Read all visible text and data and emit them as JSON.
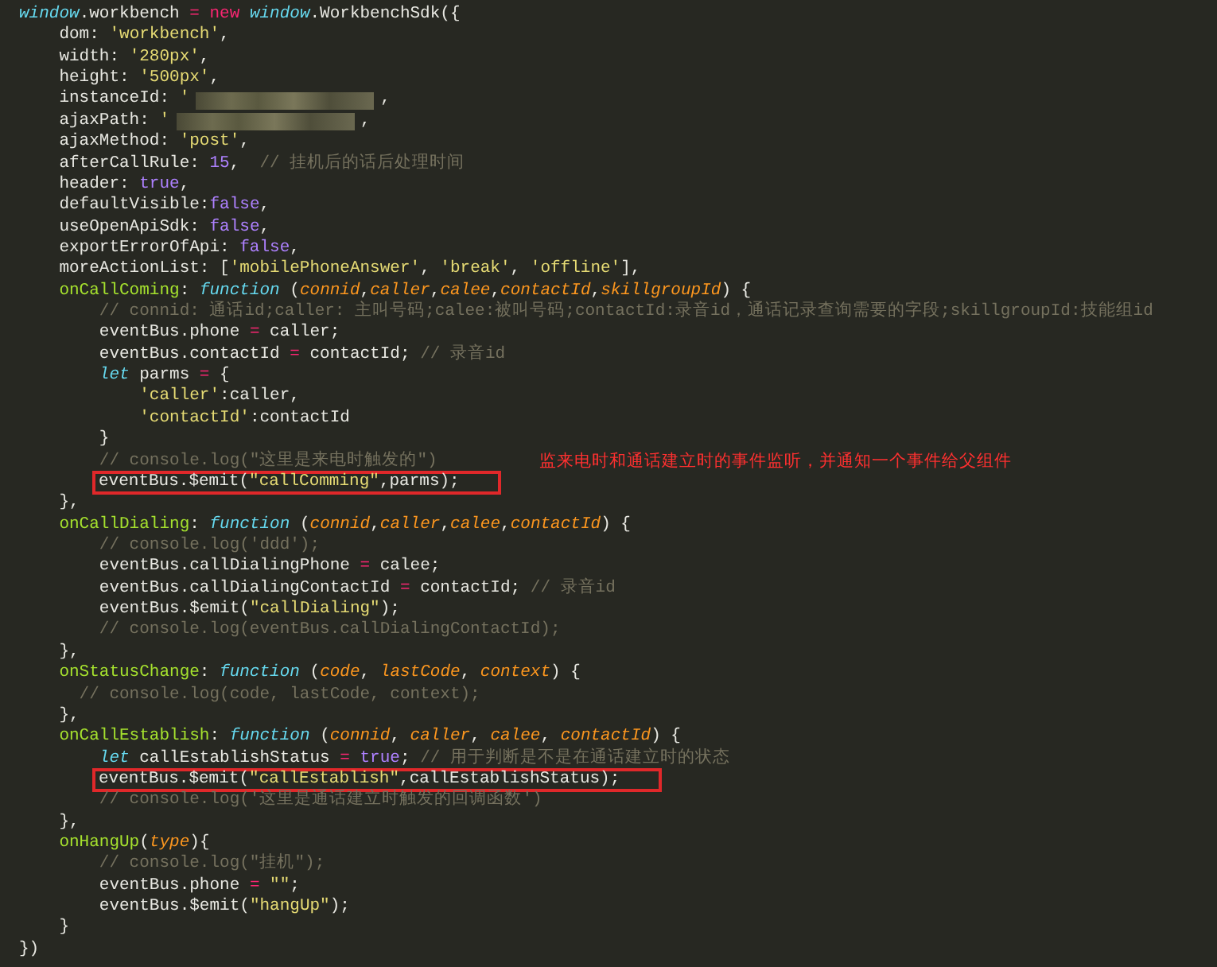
{
  "code_lines": [
    {
      "segments": [
        {
          "kind": "code",
          "tokens": [
            {
              "kind": "keyword",
              "text": "window"
            },
            {
              "kind": "plain",
              "text": ".workbench "
            },
            {
              "kind": "operator",
              "text": "= new"
            },
            {
              "kind": "keyword",
              "text": " window"
            },
            {
              "kind": "plain",
              "text": ".WorkbenchSdk({"
            }
          ]
        }
      ]
    },
    {
      "segments": [
        {
          "kind": "code",
          "tokens": [
            {
              "kind": "plain",
              "text": "    dom: "
            },
            {
              "kind": "string",
              "text": "'workbench'"
            },
            {
              "kind": "plain",
              "text": ","
            }
          ]
        }
      ]
    },
    {
      "segments": [
        {
          "kind": "code",
          "tokens": [
            {
              "kind": "plain",
              "text": "    width: "
            },
            {
              "kind": "string",
              "text": "'280px'"
            },
            {
              "kind": "plain",
              "text": ","
            }
          ]
        }
      ]
    },
    {
      "segments": [
        {
          "kind": "code",
          "tokens": [
            {
              "kind": "plain",
              "text": "    height: "
            },
            {
              "kind": "string",
              "text": "'500px'"
            },
            {
              "kind": "plain",
              "text": ","
            }
          ]
        }
      ]
    },
    {
      "segments": [
        {
          "kind": "code",
          "tokens": [
            {
              "kind": "plain",
              "text": "    instanceId: "
            },
            {
              "kind": "string",
              "text": "'"
            }
          ]
        },
        {
          "kind": "redacted"
        },
        {
          "kind": "code",
          "tokens": [
            {
              "kind": "plain",
              "text": ","
            }
          ]
        }
      ]
    },
    {
      "segments": [
        {
          "kind": "code",
          "tokens": [
            {
              "kind": "plain",
              "text": "    ajaxPath: "
            },
            {
              "kind": "string",
              "text": "'"
            }
          ]
        },
        {
          "kind": "redacted"
        },
        {
          "kind": "code",
          "tokens": [
            {
              "kind": "plain",
              "text": ","
            }
          ]
        }
      ]
    },
    {
      "segments": [
        {
          "kind": "code",
          "tokens": [
            {
              "kind": "plain",
              "text": "    ajaxMethod: "
            },
            {
              "kind": "string",
              "text": "'post'"
            },
            {
              "kind": "plain",
              "text": ","
            }
          ]
        }
      ]
    },
    {
      "segments": [
        {
          "kind": "code",
          "tokens": [
            {
              "kind": "plain",
              "text": "    afterCallRule: "
            },
            {
              "kind": "literal",
              "text": "15"
            },
            {
              "kind": "plain",
              "text": ",  "
            },
            {
              "kind": "comment",
              "text": "// 挂机后的话后处理时间"
            }
          ]
        }
      ]
    },
    {
      "segments": [
        {
          "kind": "code",
          "tokens": [
            {
              "kind": "plain",
              "text": "    header: "
            },
            {
              "kind": "literal",
              "text": "true"
            },
            {
              "kind": "plain",
              "text": ","
            }
          ]
        }
      ]
    },
    {
      "segments": [
        {
          "kind": "code",
          "tokens": [
            {
              "kind": "plain",
              "text": "    defaultVisible:"
            },
            {
              "kind": "literal",
              "text": "false"
            },
            {
              "kind": "plain",
              "text": ","
            }
          ]
        }
      ]
    },
    {
      "segments": [
        {
          "kind": "code",
          "tokens": [
            {
              "kind": "plain",
              "text": "    useOpenApiSdk: "
            },
            {
              "kind": "literal",
              "text": "false"
            },
            {
              "kind": "plain",
              "text": ","
            }
          ]
        }
      ]
    },
    {
      "segments": [
        {
          "kind": "code",
          "tokens": [
            {
              "kind": "plain",
              "text": "    exportErrorOfApi: "
            },
            {
              "kind": "literal",
              "text": "false"
            },
            {
              "kind": "plain",
              "text": ","
            }
          ]
        }
      ]
    },
    {
      "segments": [
        {
          "kind": "code",
          "tokens": [
            {
              "kind": "plain",
              "text": "    moreActionList: ["
            },
            {
              "kind": "string",
              "text": "'mobilePhoneAnswer'"
            },
            {
              "kind": "plain",
              "text": ", "
            },
            {
              "kind": "string",
              "text": "'break'"
            },
            {
              "kind": "plain",
              "text": ", "
            },
            {
              "kind": "string",
              "text": "'offline'"
            },
            {
              "kind": "plain",
              "text": "],"
            }
          ]
        }
      ]
    },
    {
      "segments": [
        {
          "kind": "code",
          "tokens": [
            {
              "kind": "name",
              "text": "    onCallComing"
            },
            {
              "kind": "plain",
              "text": ": "
            },
            {
              "kind": "keyword",
              "text": "function"
            },
            {
              "kind": "plain",
              "text": " ("
            },
            {
              "kind": "param",
              "text": "connid"
            },
            {
              "kind": "plain",
              "text": ","
            },
            {
              "kind": "param",
              "text": "caller"
            },
            {
              "kind": "plain",
              "text": ","
            },
            {
              "kind": "param",
              "text": "calee"
            },
            {
              "kind": "plain",
              "text": ","
            },
            {
              "kind": "param",
              "text": "contactId"
            },
            {
              "kind": "plain",
              "text": ","
            },
            {
              "kind": "param",
              "text": "skillgroupId"
            },
            {
              "kind": "plain",
              "text": ") {"
            }
          ]
        }
      ]
    },
    {
      "segments": [
        {
          "kind": "code",
          "tokens": [
            {
              "kind": "comment",
              "text": "        // connid: 通话id;caller: 主叫号码;calee:被叫号码;contactId:录音id，通话记录查询需要的字段;skillgroupId:技能组id"
            }
          ]
        }
      ]
    },
    {
      "segments": [
        {
          "kind": "code",
          "tokens": [
            {
              "kind": "plain",
              "text": "        eventBus.phone "
            },
            {
              "kind": "operator",
              "text": "="
            },
            {
              "kind": "plain",
              "text": " caller;"
            }
          ]
        }
      ]
    },
    {
      "segments": [
        {
          "kind": "code",
          "tokens": [
            {
              "kind": "plain",
              "text": "        eventBus.contactId "
            },
            {
              "kind": "operator",
              "text": "="
            },
            {
              "kind": "plain",
              "text": " contactId; "
            },
            {
              "kind": "comment",
              "text": "// 录音id"
            }
          ]
        }
      ]
    },
    {
      "segments": [
        {
          "kind": "code",
          "tokens": [
            {
              "kind": "keyword",
              "text": "        let"
            },
            {
              "kind": "plain",
              "text": " parms "
            },
            {
              "kind": "operator",
              "text": "="
            },
            {
              "kind": "plain",
              "text": " {"
            }
          ]
        }
      ]
    },
    {
      "segments": [
        {
          "kind": "code",
          "tokens": [
            {
              "kind": "string",
              "text": "            'caller'"
            },
            {
              "kind": "plain",
              "text": ":caller,"
            }
          ]
        }
      ]
    },
    {
      "segments": [
        {
          "kind": "code",
          "tokens": [
            {
              "kind": "string",
              "text": "            'contactId'"
            },
            {
              "kind": "plain",
              "text": ":contactId"
            }
          ]
        }
      ]
    },
    {
      "segments": [
        {
          "kind": "code",
          "tokens": [
            {
              "kind": "plain",
              "text": "        }"
            }
          ]
        }
      ]
    },
    {
      "segments": [
        {
          "kind": "code",
          "tokens": [
            {
              "kind": "comment",
              "text": "        // console.log(\"这里是来电时触发的\")"
            }
          ]
        },
        {
          "kind": "note",
          "text": "监来电时和通话建立时的事件监听，并通知一个事件给父组件"
        }
      ]
    },
    {
      "segments": [
        {
          "kind": "boxed",
          "tokens": [
            {
              "kind": "plain",
              "text": "eventBus.$emit("
            },
            {
              "kind": "string",
              "text": "\"callComming\""
            },
            {
              "kind": "plain",
              "text": ",parms);"
            }
          ]
        }
      ]
    },
    {
      "segments": [
        {
          "kind": "code",
          "tokens": [
            {
              "kind": "plain",
              "text": "    },"
            }
          ]
        }
      ]
    },
    {
      "segments": [
        {
          "kind": "code",
          "tokens": [
            {
              "kind": "name",
              "text": "    onCallDialing"
            },
            {
              "kind": "plain",
              "text": ": "
            },
            {
              "kind": "keyword",
              "text": "function"
            },
            {
              "kind": "plain",
              "text": " ("
            },
            {
              "kind": "param",
              "text": "connid"
            },
            {
              "kind": "plain",
              "text": ","
            },
            {
              "kind": "param",
              "text": "caller"
            },
            {
              "kind": "plain",
              "text": ","
            },
            {
              "kind": "param",
              "text": "calee"
            },
            {
              "kind": "plain",
              "text": ","
            },
            {
              "kind": "param",
              "text": "contactId"
            },
            {
              "kind": "plain",
              "text": ") {"
            }
          ]
        }
      ]
    },
    {
      "segments": [
        {
          "kind": "code",
          "tokens": [
            {
              "kind": "comment",
              "text": "        // console.log('ddd');"
            }
          ]
        }
      ]
    },
    {
      "segments": [
        {
          "kind": "code",
          "tokens": [
            {
              "kind": "plain",
              "text": "        eventBus.callDialingPhone "
            },
            {
              "kind": "operator",
              "text": "="
            },
            {
              "kind": "plain",
              "text": " calee;"
            }
          ]
        }
      ]
    },
    {
      "segments": [
        {
          "kind": "code",
          "tokens": [
            {
              "kind": "plain",
              "text": "        eventBus.callDialingContactId "
            },
            {
              "kind": "operator",
              "text": "="
            },
            {
              "kind": "plain",
              "text": " contactId; "
            },
            {
              "kind": "comment",
              "text": "// 录音id"
            }
          ]
        }
      ]
    },
    {
      "segments": [
        {
          "kind": "code",
          "tokens": [
            {
              "kind": "plain",
              "text": "        eventBus.$emit("
            },
            {
              "kind": "string",
              "text": "\"callDialing\""
            },
            {
              "kind": "plain",
              "text": ");"
            }
          ]
        }
      ]
    },
    {
      "segments": [
        {
          "kind": "code",
          "tokens": [
            {
              "kind": "comment",
              "text": "        // console.log(eventBus.callDialingContactId);"
            }
          ]
        }
      ]
    },
    {
      "segments": [
        {
          "kind": "code",
          "tokens": [
            {
              "kind": "plain",
              "text": "    },"
            }
          ]
        }
      ]
    },
    {
      "segments": [
        {
          "kind": "code",
          "tokens": [
            {
              "kind": "name",
              "text": "    onStatusChange"
            },
            {
              "kind": "plain",
              "text": ": "
            },
            {
              "kind": "keyword",
              "text": "function"
            },
            {
              "kind": "plain",
              "text": " ("
            },
            {
              "kind": "param",
              "text": "code"
            },
            {
              "kind": "plain",
              "text": ", "
            },
            {
              "kind": "param",
              "text": "lastCode"
            },
            {
              "kind": "plain",
              "text": ", "
            },
            {
              "kind": "param",
              "text": "context"
            },
            {
              "kind": "plain",
              "text": ") {"
            }
          ]
        }
      ]
    },
    {
      "segments": [
        {
          "kind": "code",
          "tokens": [
            {
              "kind": "comment",
              "text": "      // console.log(code, lastCode, context);"
            }
          ]
        }
      ]
    },
    {
      "segments": [
        {
          "kind": "code",
          "tokens": [
            {
              "kind": "plain",
              "text": "    },"
            }
          ]
        }
      ]
    },
    {
      "segments": [
        {
          "kind": "code",
          "tokens": [
            {
              "kind": "name",
              "text": "    onCallEstablish"
            },
            {
              "kind": "plain",
              "text": ": "
            },
            {
              "kind": "keyword",
              "text": "function"
            },
            {
              "kind": "plain",
              "text": " ("
            },
            {
              "kind": "param",
              "text": "connid"
            },
            {
              "kind": "plain",
              "text": ", "
            },
            {
              "kind": "param",
              "text": "caller"
            },
            {
              "kind": "plain",
              "text": ", "
            },
            {
              "kind": "param",
              "text": "calee"
            },
            {
              "kind": "plain",
              "text": ", "
            },
            {
              "kind": "param",
              "text": "contactId"
            },
            {
              "kind": "plain",
              "text": ") {"
            }
          ]
        }
      ]
    },
    {
      "segments": [
        {
          "kind": "code",
          "tokens": [
            {
              "kind": "keyword",
              "text": "        let"
            },
            {
              "kind": "plain",
              "text": " callEstablishStatus "
            },
            {
              "kind": "operator",
              "text": "="
            },
            {
              "kind": "literal",
              "text": " true"
            },
            {
              "kind": "plain",
              "text": "; "
            },
            {
              "kind": "comment",
              "text": "// 用于判断是不是在通话建立时的状态"
            }
          ]
        }
      ]
    },
    {
      "segments": [
        {
          "kind": "boxed",
          "tokens": [
            {
              "kind": "plain",
              "text": "eventBus.$emit("
            },
            {
              "kind": "string",
              "text": "\"callEstablish\""
            },
            {
              "kind": "plain",
              "text": ",callEstablishStatus);"
            }
          ]
        }
      ]
    },
    {
      "segments": [
        {
          "kind": "code",
          "tokens": [
            {
              "kind": "comment",
              "text": "        // console.log('这里是通话建立时触发的回调函数')"
            }
          ]
        }
      ]
    },
    {
      "segments": [
        {
          "kind": "code",
          "tokens": [
            {
              "kind": "plain",
              "text": "    },"
            }
          ]
        }
      ]
    },
    {
      "segments": [
        {
          "kind": "code",
          "tokens": [
            {
              "kind": "name",
              "text": "    onHangUp"
            },
            {
              "kind": "plain",
              "text": "("
            },
            {
              "kind": "param",
              "text": "type"
            },
            {
              "kind": "plain",
              "text": "){"
            }
          ]
        }
      ]
    },
    {
      "segments": [
        {
          "kind": "code",
          "tokens": [
            {
              "kind": "comment",
              "text": "        // console.log(\"挂机\");"
            }
          ]
        }
      ]
    },
    {
      "segments": [
        {
          "kind": "code",
          "tokens": [
            {
              "kind": "plain",
              "text": "        eventBus.phone "
            },
            {
              "kind": "operator",
              "text": "="
            },
            {
              "kind": "string",
              "text": " \"\""
            },
            {
              "kind": "plain",
              "text": ";"
            }
          ]
        }
      ]
    },
    {
      "segments": [
        {
          "kind": "code",
          "tokens": [
            {
              "kind": "plain",
              "text": "        eventBus.$emit("
            },
            {
              "kind": "string",
              "text": "\"hangUp\""
            },
            {
              "kind": "plain",
              "text": ");"
            }
          ]
        }
      ]
    },
    {
      "segments": [
        {
          "kind": "code",
          "tokens": [
            {
              "kind": "plain",
              "text": "    }"
            }
          ]
        }
      ]
    },
    {
      "segments": [
        {
          "kind": "code",
          "tokens": [
            {
              "kind": "plain",
              "text": "})"
            }
          ]
        }
      ]
    }
  ]
}
